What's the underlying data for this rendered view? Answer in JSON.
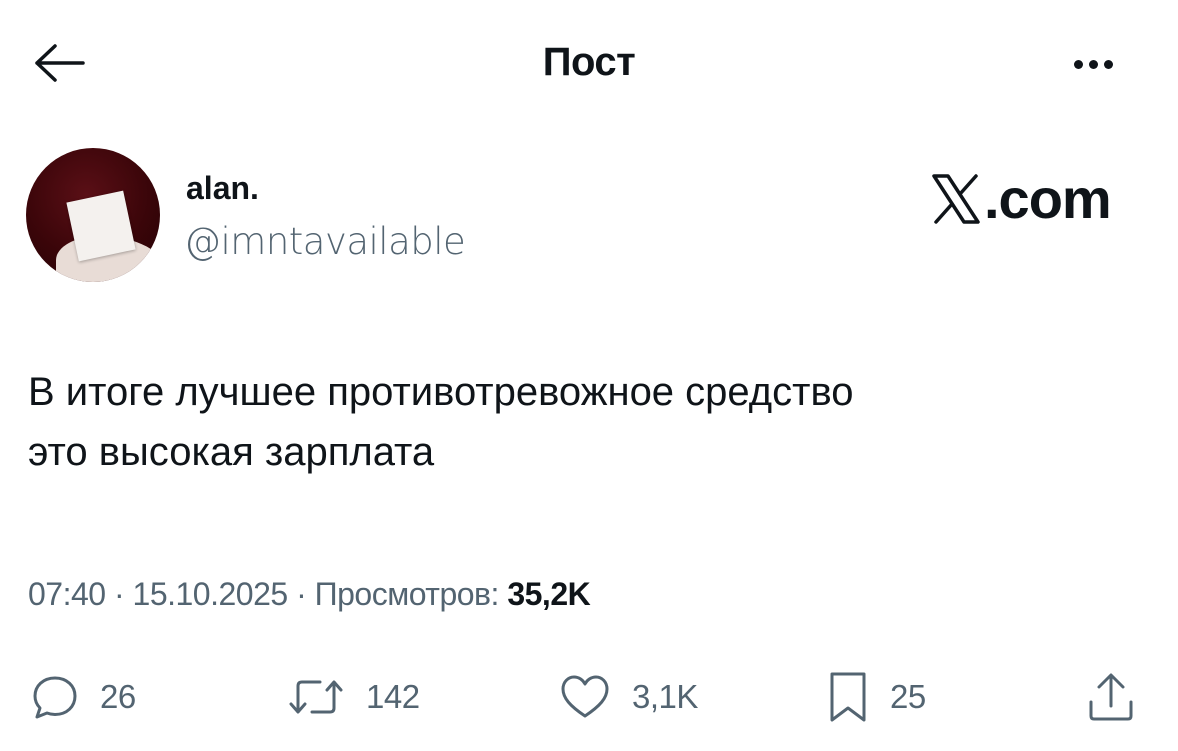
{
  "header": {
    "title": "Пост",
    "back_icon": "arrow-left-icon",
    "more_icon": "more-horizontal-icon"
  },
  "author": {
    "display_name": "alan.",
    "handle": "@imntavailable"
  },
  "watermark": {
    "text": ".com",
    "logo_icon": "x-logo-icon"
  },
  "tweet": {
    "text_line1": "В итоге лучшее противотревожное средство",
    "text_line2": "это высокая зарплата"
  },
  "meta": {
    "time": "07:40",
    "separator": "·",
    "date": "15.10.2025",
    "views_label": "Просмотров:",
    "views_count": "35,2K"
  },
  "actions": {
    "replies": "26",
    "reposts": "142",
    "likes": "3,1K",
    "bookmarks": "25"
  },
  "colors": {
    "text": "#0f1419",
    "secondary": "#536471",
    "background": "#ffffff"
  }
}
